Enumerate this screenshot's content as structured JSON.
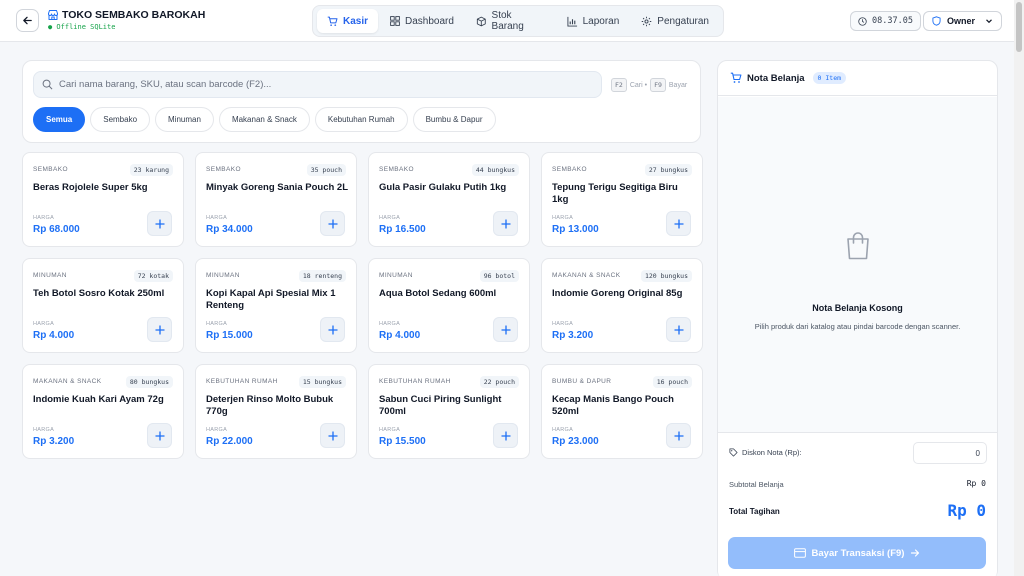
{
  "app": {
    "title": "TOKO SEMBAKO BAROKAH",
    "status": "● Offline SQLite"
  },
  "nav": [
    {
      "label": "Kasir",
      "icon": "cart-icon",
      "active": true
    },
    {
      "label": "Dashboard",
      "icon": "grid-icon",
      "active": false
    },
    {
      "label": "Stok Barang",
      "icon": "box-icon",
      "active": false
    },
    {
      "label": "Laporan",
      "icon": "chart-icon",
      "active": false
    },
    {
      "label": "Pengaturan",
      "icon": "gear-icon",
      "active": false
    }
  ],
  "clock": "08.37.05",
  "user": {
    "name": "Owner"
  },
  "search": {
    "placeholder": "Cari nama barang, SKU, atau scan barcode (F2)...",
    "value": "",
    "shortcut_search_key": "F2",
    "shortcut_search_label": "Cari •",
    "shortcut_pay_key": "F9",
    "shortcut_pay_label": "Bayar"
  },
  "categories": [
    "Semua",
    "Sembako",
    "Minuman",
    "Makanan & Snack",
    "Kebutuhan Rumah",
    "Bumbu & Dapur"
  ],
  "price_label": "HARGA",
  "products": [
    {
      "category": "SEMBAKO",
      "stock": "23 karung",
      "name": "Beras Rojolele Super 5kg",
      "price": "Rp 68.000"
    },
    {
      "category": "SEMBAKO",
      "stock": "35 pouch",
      "name": "Minyak Goreng Sania Pouch 2L",
      "price": "Rp 34.000"
    },
    {
      "category": "SEMBAKO",
      "stock": "44 bungkus",
      "name": "Gula Pasir Gulaku Putih 1kg",
      "price": "Rp 16.500"
    },
    {
      "category": "SEMBAKO",
      "stock": "27 bungkus",
      "name": "Tepung Terigu Segitiga Biru 1kg",
      "price": "Rp 13.000"
    },
    {
      "category": "MINUMAN",
      "stock": "72 kotak",
      "name": "Teh Botol Sosro Kotak 250ml",
      "price": "Rp 4.000"
    },
    {
      "category": "MINUMAN",
      "stock": "18 renteng",
      "name": "Kopi Kapal Api Spesial Mix 1 Renteng",
      "price": "Rp 15.000"
    },
    {
      "category": "MINUMAN",
      "stock": "96 botol",
      "name": "Aqua Botol Sedang 600ml",
      "price": "Rp 4.000"
    },
    {
      "category": "MAKANAN & SNACK",
      "stock": "120 bungkus",
      "name": "Indomie Goreng Original 85g",
      "price": "Rp 3.200"
    },
    {
      "category": "MAKANAN & SNACK",
      "stock": "80 bungkus",
      "name": "Indomie Kuah Kari Ayam 72g",
      "price": "Rp 3.200"
    },
    {
      "category": "KEBUTUHAN RUMAH",
      "stock": "15 bungkus",
      "name": "Deterjen Rinso Molto Bubuk 770g",
      "price": "Rp 22.000"
    },
    {
      "category": "KEBUTUHAN RUMAH",
      "stock": "22 pouch",
      "name": "Sabun Cuci Piring Sunlight 700ml",
      "price": "Rp 15.500"
    },
    {
      "category": "BUMBU & DAPUR",
      "stock": "16 pouch",
      "name": "Kecap Manis Bango Pouch 520ml",
      "price": "Rp 23.000"
    }
  ],
  "cart": {
    "title": "Nota Belanja",
    "badge": "0 Item",
    "empty_title": "Nota Belanja Kosong",
    "empty_desc": "Pilih produk dari katalog atau pindai barcode dengan scanner.",
    "discount_label": "Diskon Nota (Rp):",
    "discount_value": "0",
    "subtotal_label": "Subtotal Belanja",
    "subtotal_value": "Rp 0",
    "total_label": "Total Tagihan",
    "total_value": "Rp 0",
    "pay_label": "Bayar Transaksi (F9)"
  },
  "colors": {
    "accent": "#1d6ff5",
    "pay_disabled": "#93bdfb",
    "status_online": "#16a34a"
  }
}
